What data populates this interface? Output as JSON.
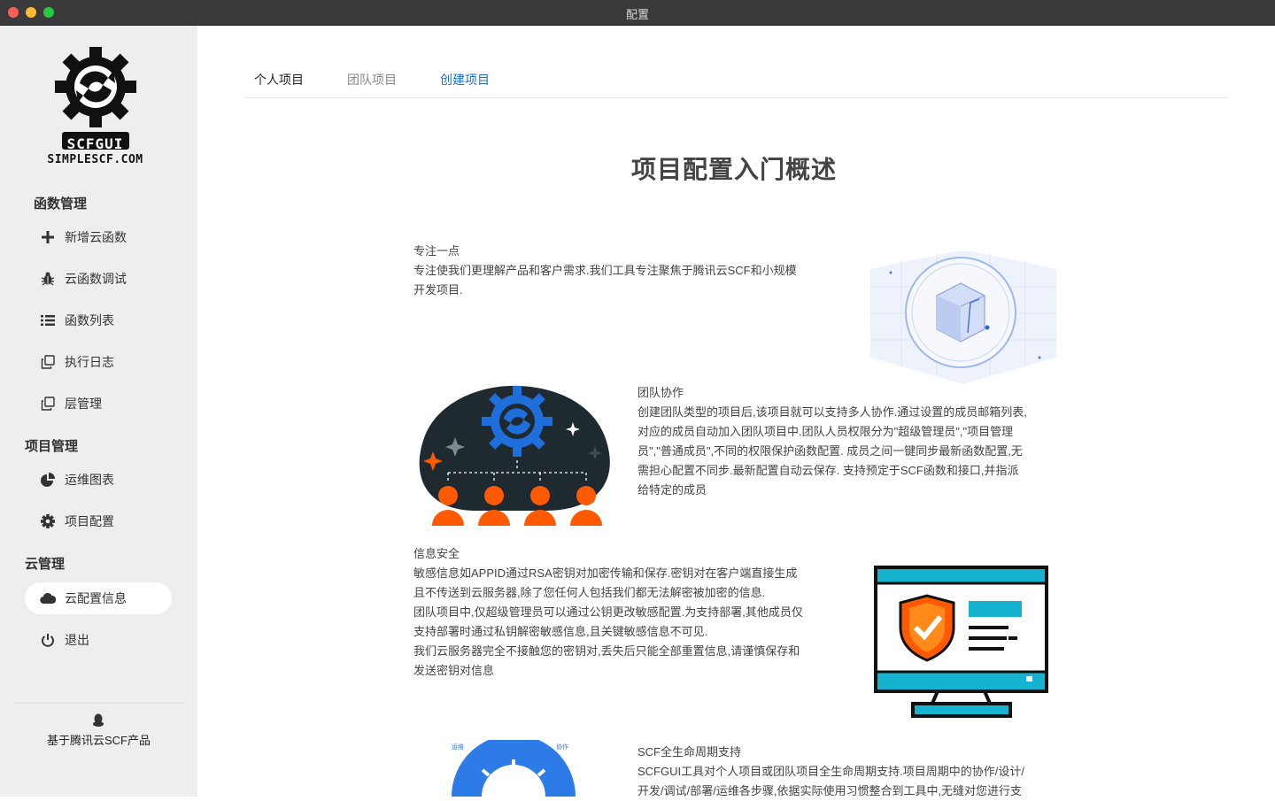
{
  "window": {
    "title": "配置"
  },
  "logo": {
    "line1": "SCFGUI",
    "line2": "SIMPLESCF.COM"
  },
  "sidebar": {
    "sections": [
      {
        "title": "函数管理"
      },
      {
        "title": "项目管理"
      },
      {
        "title": "云管理"
      }
    ],
    "items": [
      {
        "label": "新增云函数",
        "icon": "plus-icon"
      },
      {
        "label": "云函数调试",
        "icon": "bug-icon"
      },
      {
        "label": "函数列表",
        "icon": "list-icon"
      },
      {
        "label": "执行日志",
        "icon": "copy-icon"
      },
      {
        "label": "层管理",
        "icon": "copy-icon"
      },
      {
        "label": "运维图表",
        "icon": "pie-chart-icon"
      },
      {
        "label": "项目配置",
        "icon": "gear-icon"
      },
      {
        "label": "云配置信息",
        "icon": "cloud-icon",
        "active": true
      },
      {
        "label": "退出",
        "icon": "power-icon"
      }
    ],
    "footer": "基于腾讯云SCF产品"
  },
  "tabs": [
    {
      "label": "个人项目"
    },
    {
      "label": "团队项目"
    },
    {
      "label": "创建项目"
    }
  ],
  "main": {
    "title": "项目配置入门概述",
    "blocks": [
      {
        "title": "专注一点",
        "lines": [
          "专注使我们更理解产品和客户需求.我们工具专注聚焦于腾讯云SCF和小规模",
          "开发项目."
        ]
      },
      {
        "title": "团队协作",
        "lines": [
          "创建团队类型的项目后,该项目就可以支持多人协作.通过设置的成员邮箱列表,",
          "对应的成员自动加入团队项目中.团队人员权限分为\"超级管理员\",\"项目管理",
          "员\",\"普通成员\",不同的权限保护函数配置. 成员之间一键同步最新函数配置,无",
          "需担心配置不同步.最新配置自动云保存. 支持预定于SCF函数和接口,并指派",
          "给特定的成员"
        ]
      },
      {
        "title": "信息安全",
        "lines": [
          "敏感信息如APPID通过RSA密钥对加密传输和保存.密钥对在客户端直接生成",
          "且不传送到云服务器,除了您任何人包括我们都无法解密被加密的信息.",
          "团队项目中,仅超级管理员可以通过公钥更改敏感配置.为支持部署,其他成员仅",
          "支持部署时通过私钥解密敏感信息,且关键敏感信息不可见.",
          "我们云服务器完全不接触您的密钥对,丢失后只能全部重置信息,请谨慎保存和",
          "发送密钥对信息"
        ]
      },
      {
        "title": "SCF全生命周期支持",
        "lines": [
          "SCFGUI工具对个人项目或团队项目全生命周期支持.项目周期中的协作/设计/",
          "开发/调试/部署/运维各步骤,依据实际使用习惯整合到工具中,无缝对您进行支"
        ]
      }
    ],
    "lifecycle_labels": [
      "运维",
      "协作"
    ]
  },
  "colors": {
    "accent": "#1e6fdc",
    "orange": "#ff5a00",
    "cyan": "#15b3cf",
    "dark": "#1f2a30"
  }
}
